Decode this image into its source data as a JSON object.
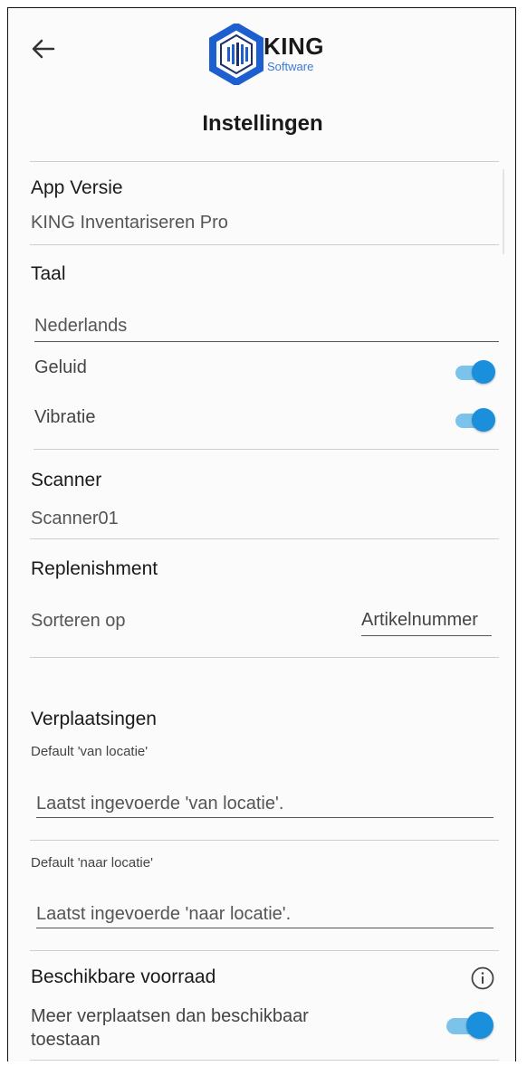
{
  "header": {
    "logo_text": "KING",
    "logo_sub": "Software",
    "title": "Instellingen"
  },
  "app_version": {
    "label": "App Versie",
    "value": "KING Inventariseren Pro"
  },
  "language": {
    "label": "Taal",
    "value": "Nederlands"
  },
  "sound": {
    "label": "Geluid",
    "on": true
  },
  "vibration": {
    "label": "Vibratie",
    "on": true
  },
  "scanner": {
    "label": "Scanner",
    "value": "Scanner01"
  },
  "replenishment": {
    "label": "Replenishment",
    "sort_label": "Sorteren op",
    "sort_value": "Artikelnummer"
  },
  "moves": {
    "label": "Verplaatsingen",
    "from_label": "Default 'van locatie'",
    "from_placeholder": "Laatst ingevoerde 'van locatie'.",
    "to_label": "Default 'naar locatie'",
    "to_placeholder": "Laatst ingevoerde 'naar locatie'."
  },
  "stock": {
    "label": "Beschikbare voorraad",
    "allow_line1": "Meer verplaatsen dan beschikbaar",
    "allow_line2": "toestaan",
    "on": true
  },
  "colors": {
    "accent": "#1a8fdc",
    "track": "#7cc3ec",
    "logo_blue": "#1e5fd0"
  }
}
